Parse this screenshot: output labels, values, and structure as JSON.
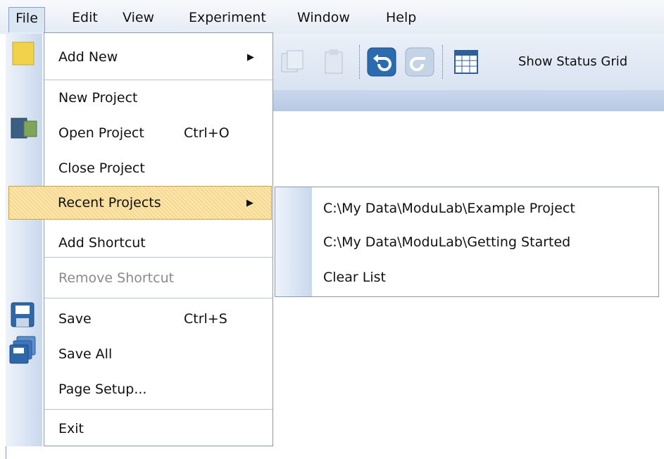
{
  "menubar": {
    "items": [
      {
        "label": "File"
      },
      {
        "label": "Edit"
      },
      {
        "label": "View"
      },
      {
        "label": "Experiment"
      },
      {
        "label": "Window"
      },
      {
        "label": "Help"
      }
    ]
  },
  "toolbar": {
    "show_status_grid": "Show Status Grid"
  },
  "file_menu": {
    "add_new": "Add New",
    "new_project": "New Project",
    "open_project": "Open Project",
    "open_project_shortcut": "Ctrl+O",
    "close_project": "Close Project",
    "recent_projects": "Recent Projects",
    "add_shortcut": "Add Shortcut",
    "remove_shortcut": "Remove Shortcut",
    "save": "Save",
    "save_shortcut": "Ctrl+S",
    "save_all": "Save All",
    "page_setup": "Page Setup...",
    "exit": "Exit"
  },
  "recent_submenu": {
    "items": [
      {
        "label": "C:\\My Data\\ModuLab\\Example Project"
      },
      {
        "label": "C:\\My Data\\ModuLab\\Getting Started"
      },
      {
        "label": "Clear List"
      }
    ]
  },
  "colors": {
    "highlight": "#f6d98f",
    "menu_border": "#8a9aae",
    "gradient_light": "#eef3fa",
    "gradient_dark": "#c9d8ee"
  }
}
